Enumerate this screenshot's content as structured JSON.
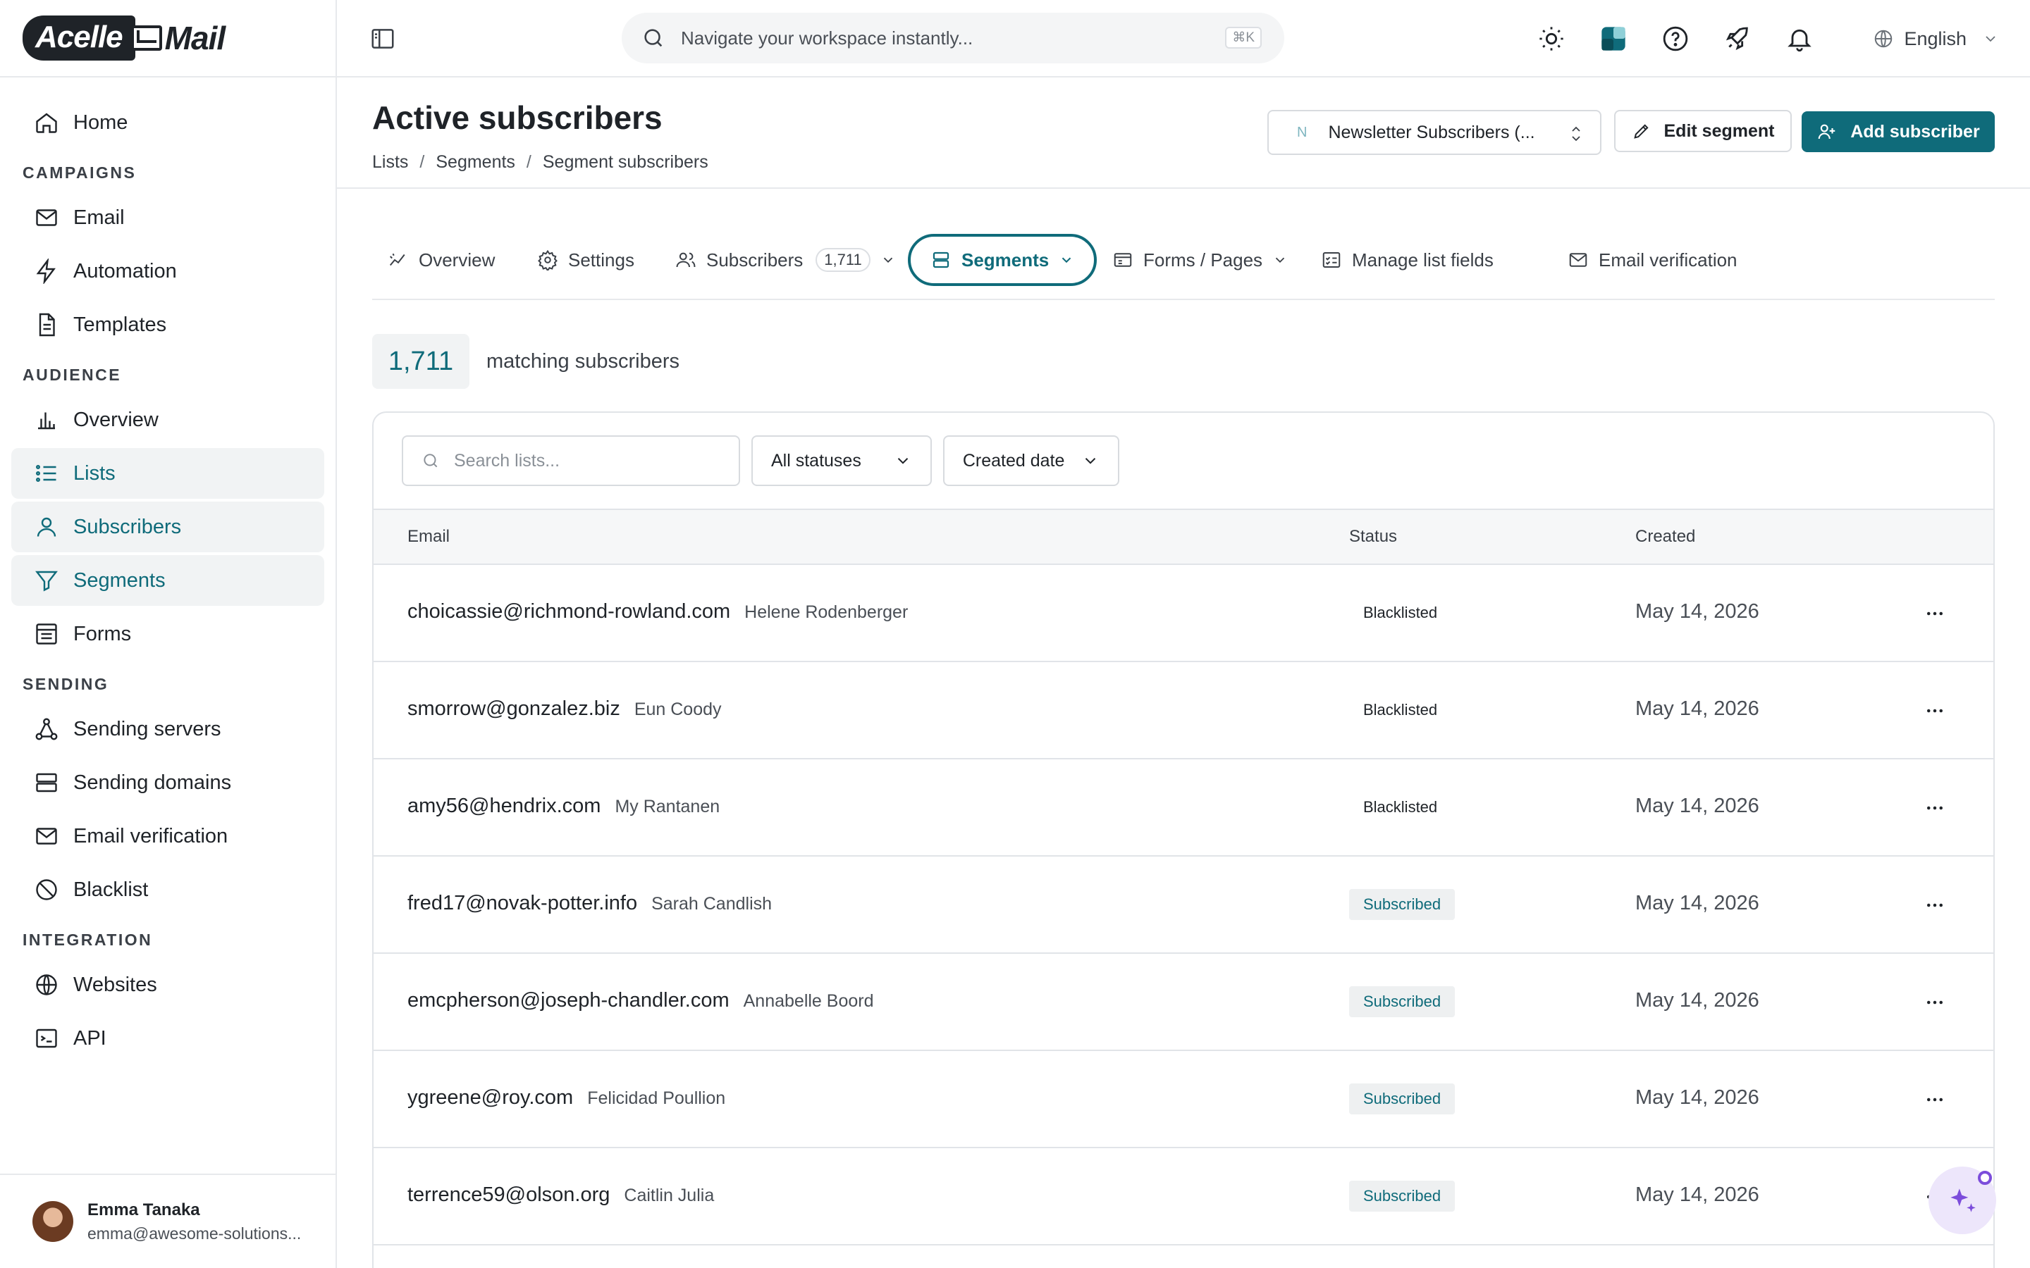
{
  "app": {
    "logo_left": "Acelle",
    "logo_right": "Mail"
  },
  "sidebar": {
    "home": "Home",
    "campaigns_section": "CAMPAIGNS",
    "email": "Email",
    "automation": "Automation",
    "templates": "Templates",
    "audience_section": "AUDIENCE",
    "overview": "Overview",
    "lists": "Lists",
    "subscribers": "Subscribers",
    "segments": "Segments",
    "forms": "Forms",
    "sending_section": "SENDING",
    "sending_servers": "Sending servers",
    "sending_domains": "Sending domains",
    "email_verification": "Email verification",
    "blacklist": "Blacklist",
    "integration_section": "INTEGRATION",
    "websites": "Websites",
    "api": "API"
  },
  "user": {
    "name": "Emma Tanaka",
    "email": "emma@awesome-solutions..."
  },
  "topbar": {
    "search_placeholder": "Navigate your workspace instantly...",
    "shortcut": "⌘K",
    "language": "English"
  },
  "page": {
    "title": "Active subscribers",
    "breadcrumb": [
      "Lists",
      "Segments",
      "Segment subscribers"
    ],
    "segment_select_initial": "N",
    "segment_select_value": "Newsletter Subscribers (...",
    "edit_segment": "Edit segment",
    "add_subscriber": "Add subscriber"
  },
  "tabs": {
    "overview": "Overview",
    "settings": "Settings",
    "subscribers": "Subscribers",
    "subscribers_count": "1,711",
    "segments": "Segments",
    "forms_pages": "Forms / Pages",
    "manage_list_fields": "Manage list fields",
    "email_verification": "Email verification"
  },
  "stats": {
    "count": "1,711",
    "label": "matching subscribers"
  },
  "filters": {
    "search_placeholder": "Search lists...",
    "status": "All statuses",
    "sort": "Created date"
  },
  "table": {
    "headers": {
      "email": "Email",
      "status": "Status",
      "created": "Created"
    },
    "rows": [
      {
        "email": "choicassie@richmond-rowland.com",
        "name": "Helene Rodenberger",
        "status": "Blacklisted",
        "created": "May 14, 2026"
      },
      {
        "email": "smorrow@gonzalez.biz",
        "name": "Eun Coody",
        "status": "Blacklisted",
        "created": "May 14, 2026"
      },
      {
        "email": "amy56@hendrix.com",
        "name": "My Rantanen",
        "status": "Blacklisted",
        "created": "May 14, 2026"
      },
      {
        "email": "fred17@novak-potter.info",
        "name": "Sarah Candlish",
        "status": "Subscribed",
        "created": "May 14, 2026"
      },
      {
        "email": "emcpherson@joseph-chandler.com",
        "name": "Annabelle Boord",
        "status": "Subscribed",
        "created": "May 14, 2026"
      },
      {
        "email": "ygreene@roy.com",
        "name": "Felicidad Poullion",
        "status": "Subscribed",
        "created": "May 14, 2026"
      },
      {
        "email": "terrence59@olson.org",
        "name": "Caitlin Julia",
        "status": "Subscribed",
        "created": "May 14, 2026"
      }
    ]
  },
  "colors": {
    "accent": "#0f6b7a",
    "ai_purple": "#7c4ddb"
  }
}
